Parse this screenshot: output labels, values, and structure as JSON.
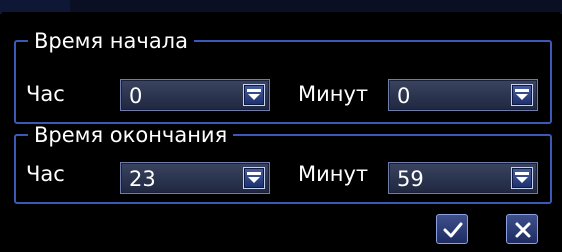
{
  "colors": {
    "background": "#000000",
    "group_border": "#3b5ab8",
    "select_fill": "#2b3450",
    "arrow_fill": "#2a3f86",
    "text": "#ffffff"
  },
  "start_time": {
    "legend": "Время начала",
    "hour_label": "Час",
    "hour_value": "0",
    "minute_label": "Минут",
    "minute_value": "0"
  },
  "end_time": {
    "legend": "Время окончания",
    "hour_label": "Час",
    "hour_value": "23",
    "minute_label": "Минут",
    "minute_value": "59"
  },
  "icons": {
    "dropdown": "chevron-down-icon",
    "confirm": "check-icon",
    "cancel": "close-icon"
  }
}
